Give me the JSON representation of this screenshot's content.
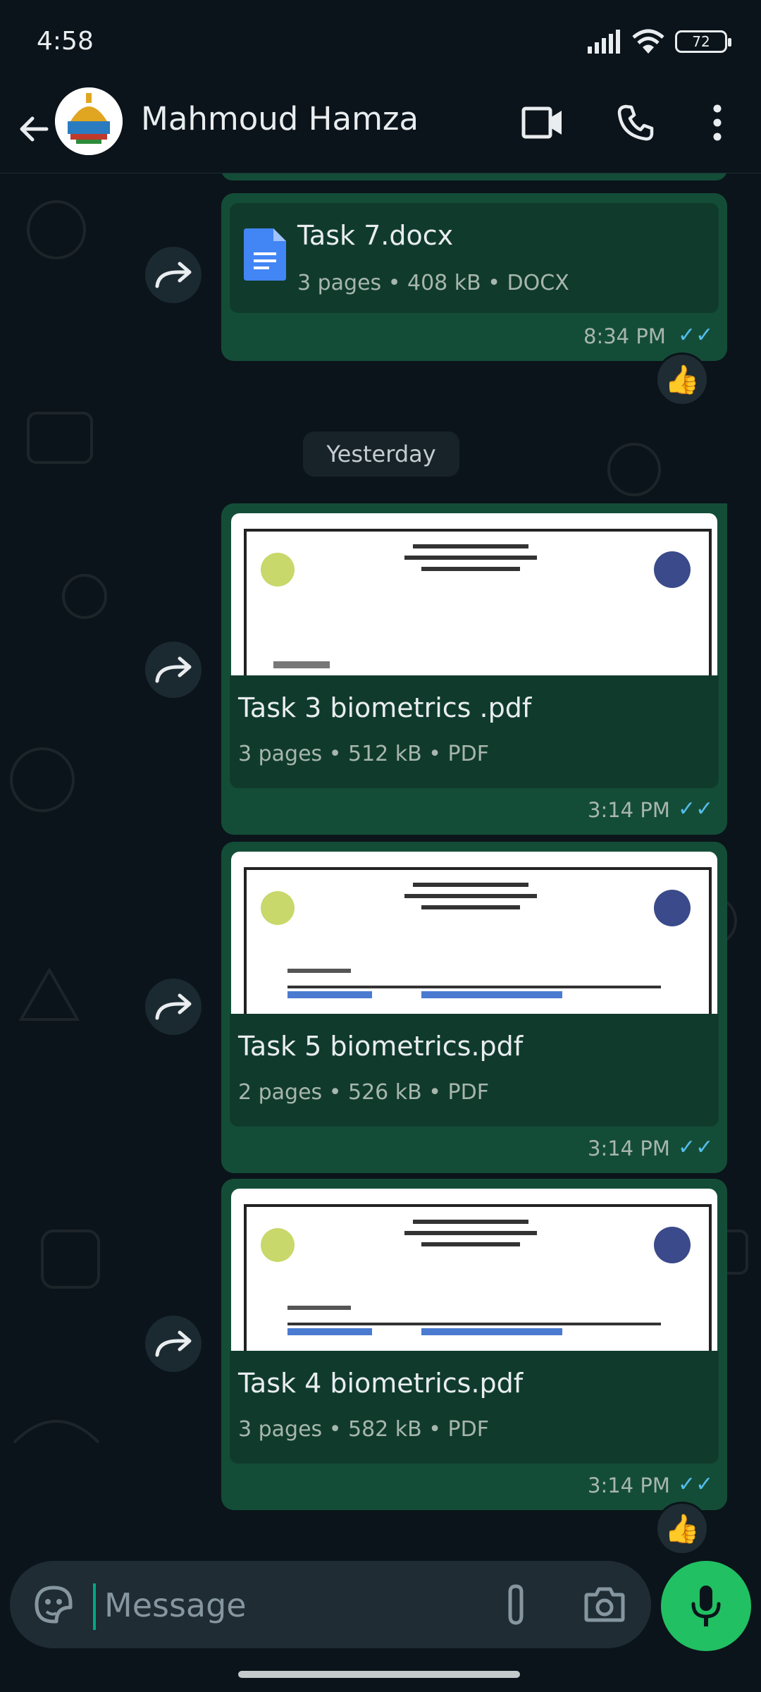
{
  "status_bar": {
    "time": "4:58",
    "battery": "72"
  },
  "header": {
    "contact_name": "Mahmoud Hamza",
    "icons": [
      "back-arrow-icon",
      "video-call-icon",
      "phone-icon",
      "more-vert-icon"
    ]
  },
  "date_divider": "Yesterday",
  "messages": [
    {
      "title": "Task 7.docx",
      "pages": "3 pages",
      "size": "408 kB",
      "type": "DOCX",
      "time": "8:34 PM",
      "reaction": "👍"
    },
    {
      "title": "Task 3 biometrics .pdf",
      "pages": "3 pages",
      "size": "512 kB",
      "type": "PDF",
      "time": "3:14 PM"
    },
    {
      "title": "Task 5 biometrics.pdf",
      "pages": "2 pages",
      "size": "526 kB",
      "type": "PDF",
      "time": "3:14 PM"
    },
    {
      "title": "Task 4 biometrics.pdf",
      "pages": "3 pages",
      "size": "582 kB",
      "type": "PDF",
      "time": "3:14 PM",
      "reaction": "👍"
    }
  ],
  "meta_separator": "•",
  "read_ticks": "✓✓",
  "composer": {
    "placeholder": "Message"
  },
  "colors": {
    "bubble": "#144d37",
    "accent": "#21c063",
    "ticks": "#53bdeb",
    "background": "#0b141a"
  }
}
